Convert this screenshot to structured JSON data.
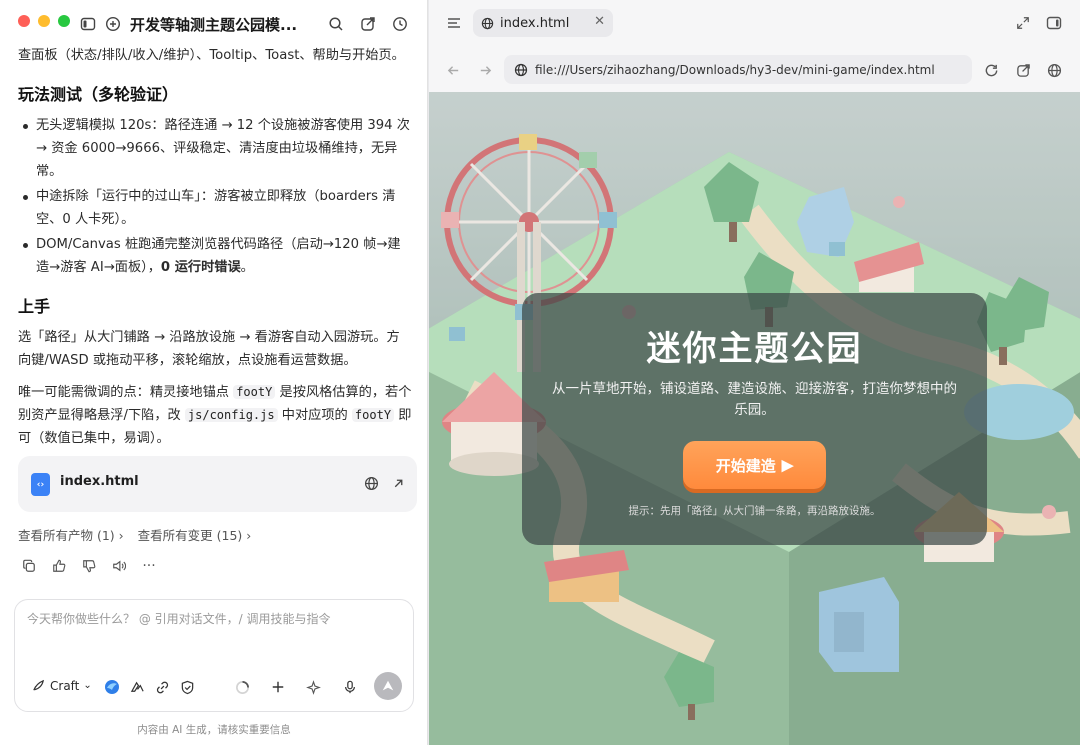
{
  "left": {
    "title": "开发等轴测主题公园模...",
    "intro_tail": "查面板（状态/排队/收入/维护）、Tooltip、Toast、帮助与开始页。",
    "section1": {
      "heading": "玩法测试（多轮验证）",
      "items": [
        "无头逻辑模拟 120s：路径连通 → 12 个设施被游客使用 394 次 → 资金 6000→9666、评级稳定、清洁度由垃圾桶维持，无异常。",
        "中途拆除「运行中的过山车」：游客被立即释放（boarders 清空、0 人卡死）。",
        "DOM/Canvas 桩跑通完整浏览器代码路径（启动→120 帧→建造→游客 AI→面板），"
      ],
      "item3_bold": "0 运行时错误",
      "item3_end": "。"
    },
    "section2": {
      "heading": "上手",
      "para1": "选「路径」从大门铺路 → 沿路放设施 → 看游客自动入园游玩。方向键/WASD 或拖动平移，滚轮缩放，点设施看运营数据。",
      "para2_a": "唯一可能需微调的点：精灵接地锚点 ",
      "para2_code1": "footY",
      "para2_b": " 是按风格估算的，若个别资产显得略悬浮/下陷，改 ",
      "para2_code2": "js/config.js",
      "para2_c": " 中对应项的 ",
      "para2_code3": "footY",
      "para2_d": " 即可（数值已集中，易调）。"
    },
    "file_card": {
      "name": "index.html",
      "icon": "code-file-icon"
    },
    "links": {
      "artifacts": "查看所有产物 (1)",
      "changes": "查看所有变更 (15)"
    },
    "composer": {
      "placeholder": "今天帮你做些什么？ @ 引用对话文件，/ 调用技能与指令",
      "mode": "Craft"
    },
    "footer": "内容由 AI 生成，请核实重要信息"
  },
  "right": {
    "tab": {
      "label": "index.html"
    },
    "url": "file:///Users/zihaozhang/Downloads/hy3-dev/mini-game/index.html",
    "hero": {
      "title": "迷你主题公园",
      "subtitle": "从一片草地开始，铺设道路、建造设施、迎接游客，打造你梦想中的乐园。",
      "button": "开始建造",
      "hint": "提示：先用「路径」从大门铺一条路，再沿路放设施。"
    }
  },
  "colors": {
    "accent_orange": "#ff8a3c",
    "panel_bg": "#3c4846",
    "grass": "#9ed9a6"
  }
}
